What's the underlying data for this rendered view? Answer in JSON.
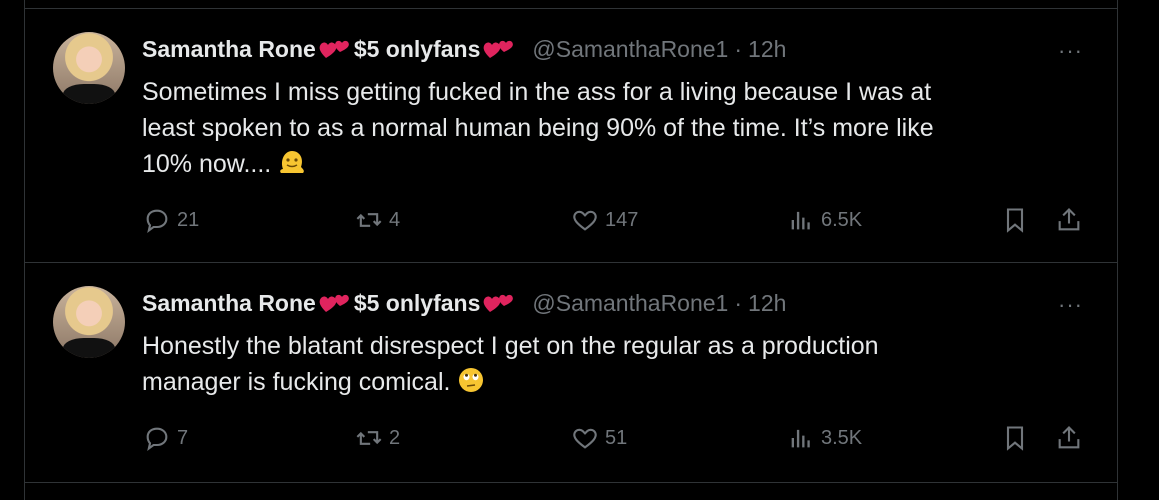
{
  "tweets": [
    {
      "name": "Samantha Rone",
      "name_suffix": "$5 onlyfans",
      "handle": "@SamanthaRone1",
      "time": "12h",
      "text_lines": [
        "Sometimes I miss getting fucked in the ass for a living because I was at",
        "least spoken to as a normal human being 90% of the time. It’s more like",
        "10% now...."
      ],
      "emoji": "melting-face",
      "replies": "21",
      "retweets": "4",
      "likes": "147",
      "views": "6.5K"
    },
    {
      "name": "Samantha Rone",
      "name_suffix": "$5 onlyfans",
      "handle": "@SamanthaRone1",
      "time": "12h",
      "text_lines": [
        "Honestly the blatant disrespect I get on the regular as a production",
        "manager is fucking comical."
      ],
      "emoji": "eye-roll-face",
      "replies": "7",
      "retweets": "2",
      "likes": "51",
      "views": "3.5K"
    }
  ],
  "ui": {
    "more_label": "···",
    "dot": "·"
  },
  "colors": {
    "bg": "#000000",
    "text": "#e7e9ea",
    "muted": "#71767b",
    "border": "#2f3336",
    "heart": "#e0245e"
  }
}
